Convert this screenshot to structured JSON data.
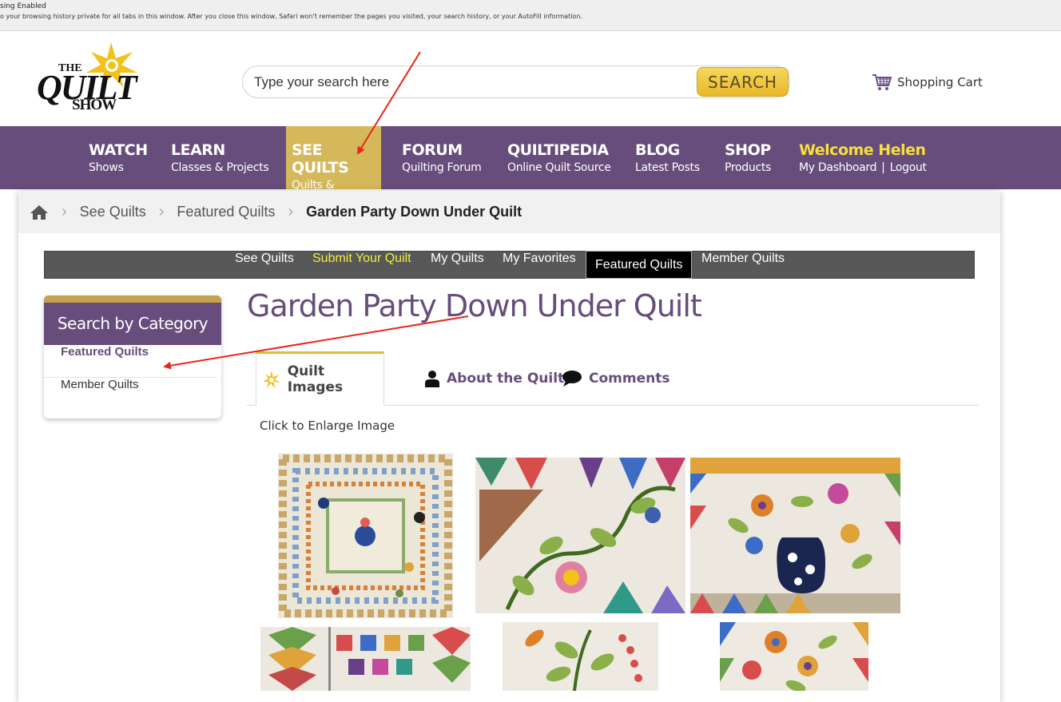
{
  "browser_banner": {
    "line1": "sing Enabled",
    "line2": "o your browsing history private for all tabs in this window. After you close this window, Safari won't remember the pages you visited, your search history, or your AutoFill information."
  },
  "logo": {
    "the": "THE",
    "quilt": "QUILT",
    "show": "SHOW"
  },
  "search": {
    "placeholder": "Type your search here",
    "button_label": "SEARCH"
  },
  "cart": {
    "label": "Shopping Cart"
  },
  "nav": {
    "items": [
      {
        "title": "WATCH",
        "sub": "Shows"
      },
      {
        "title": "LEARN",
        "sub": "Classes & Projects"
      },
      {
        "title": "SEE QUILTS",
        "sub": "Quilts & Gallery"
      },
      {
        "title": "FORUM",
        "sub": "Quilting Forum"
      },
      {
        "title": "QUILTIPEDIA",
        "sub": "Online Quilt Source"
      },
      {
        "title": "BLOG",
        "sub": "Latest Posts"
      },
      {
        "title": "SHOP",
        "sub": "Products"
      }
    ],
    "welcome": {
      "title": "Welcome Helen",
      "dashboard": "My Dashboard",
      "separator": "|",
      "logout": "Logout"
    }
  },
  "breadcrumb": {
    "items": [
      "See Quilts",
      "Featured Quilts"
    ],
    "current": "Garden Party Down Under Quilt"
  },
  "subnav": {
    "items": [
      "See Quilts",
      "Submit Your Quilt",
      "My Quilts",
      "My Favorites",
      "Featured Quilts",
      "Member Quilts"
    ]
  },
  "sidebar": {
    "heading": "Search by Category",
    "items": [
      "Featured Quilts",
      "Member Quilts"
    ]
  },
  "page_title": "Garden Party Down Under Quilt",
  "tabs": {
    "items": [
      "Quilt Images",
      "About the Quilt",
      "Comments"
    ]
  },
  "enlarge_text": "Click to Enlarge Image",
  "colors": {
    "purple": "#674d7b",
    "gold": "#d4b85a",
    "search_yellow": "#f6d75a",
    "welcome_yellow": "#f7df3c",
    "arrow_red": "#e8261c"
  }
}
